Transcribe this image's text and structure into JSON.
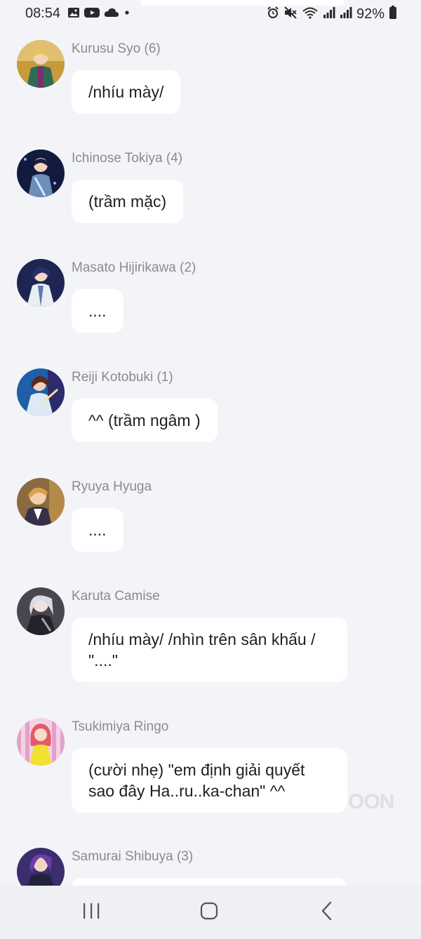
{
  "status_bar": {
    "time": "08:54",
    "battery": "92%",
    "left_icons": [
      "gallery-icon",
      "youtube-icon",
      "cloud-icon",
      "dot-icon"
    ],
    "right_icons": [
      "alarm-icon",
      "mute-icon",
      "wifi-icon",
      "signal-icon",
      "signal-icon",
      "battery-icon"
    ]
  },
  "messages": [
    {
      "sender": "Kurusu Syo (6)",
      "text": "/nhíu mày/"
    },
    {
      "sender": "Ichinose Tokiya (4)",
      "text": "(trầm mặc)"
    },
    {
      "sender": "Masato Hijirikawa (2)",
      "text": "...."
    },
    {
      "sender": "Reiji Kotobuki (1)",
      "text": "^^ (trầm ngâm )"
    },
    {
      "sender": "Ryuya Hyuga",
      "text": "...."
    },
    {
      "sender": "Karuta Camise",
      "text": "/nhíu mày/ /nhìn trên sân khấu / \"....\""
    },
    {
      "sender": "Tsukimiya Ringo",
      "text": "(cười nhẹ) \"em định giải quyết sao đây Ha..ru..ka-chan\" ^^"
    },
    {
      "sender": "Samurai Shibuya (3)",
      "text": ""
    }
  ],
  "watermark": "OON",
  "nav_bar": {
    "buttons": [
      "recent-apps-icon",
      "home-icon",
      "back-icon"
    ]
  },
  "colors": {
    "background": "#f3f4f8",
    "bubble": "#ffffff",
    "sender": "#8b8b8f",
    "text": "#1f1f1f"
  }
}
